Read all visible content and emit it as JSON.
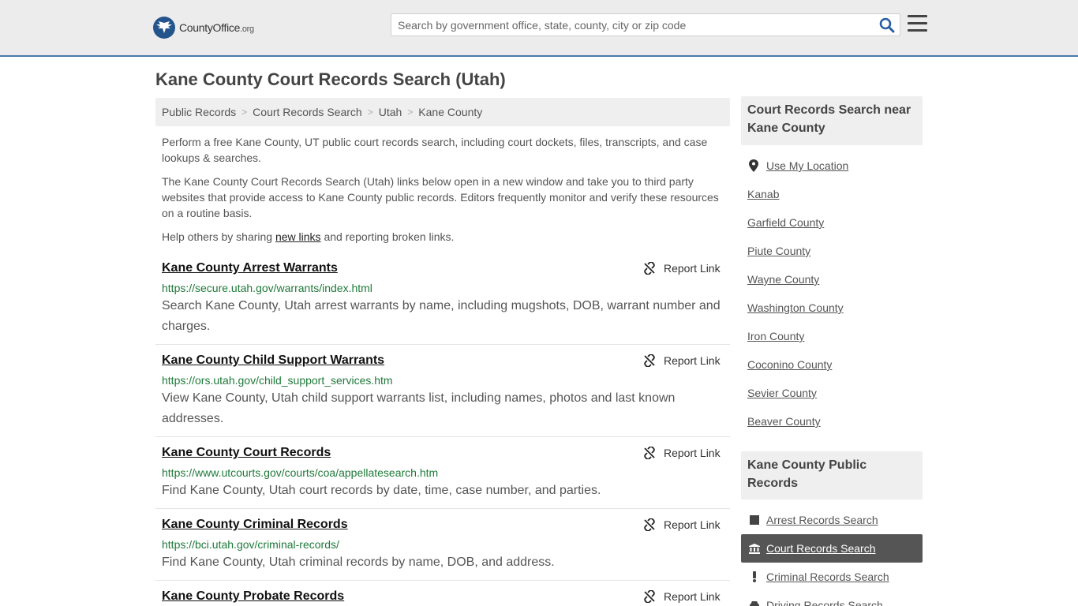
{
  "header": {
    "logo_main": "CountyOffice",
    "logo_org": ".org",
    "search_placeholder": "Search by government office, state, county, city or zip code"
  },
  "page_title": "Kane County Court Records Search (Utah)",
  "breadcrumb": [
    "Public Records",
    "Court Records Search",
    "Utah",
    "Kane County"
  ],
  "intro": {
    "p1": "Perform a free Kane County, UT public court records search, including court dockets, files, transcripts, and case lookups & searches.",
    "p2": "The Kane County Court Records Search (Utah) links below open in a new window and take you to third party websites that provide access to Kane County public records. Editors frequently monitor and verify these resources on a routine basis.",
    "p3_before": "Help others by sharing ",
    "p3_link": "new links",
    "p3_after": " and reporting broken links."
  },
  "report_label": "Report Link",
  "listings": [
    {
      "title": "Kane County Arrest Warrants",
      "url": "https://secure.utah.gov/warrants/index.html",
      "desc": "Search Kane County, Utah arrest warrants by name, including mugshots, DOB, warrant number and charges."
    },
    {
      "title": "Kane County Child Support Warrants",
      "url": "https://ors.utah.gov/child_support_services.htm",
      "desc": "View Kane County, Utah child support warrants list, including names, photos and last known addresses."
    },
    {
      "title": "Kane County Court Records",
      "url": "https://www.utcourts.gov/courts/coa/appellatesearch.htm",
      "desc": "Find Kane County, Utah court records by date, time, case number, and parties."
    },
    {
      "title": "Kane County Criminal Records",
      "url": "https://bci.utah.gov/criminal-records/",
      "desc": "Find Kane County, Utah criminal records by name, DOB, and address."
    },
    {
      "title": "Kane County Probate Records",
      "url": "",
      "desc": ""
    }
  ],
  "sidebar": {
    "nearby_heading": "Court Records Search near Kane County",
    "use_location": "Use My Location",
    "nearby": [
      "Kanab",
      "Garfield County",
      "Piute County",
      "Wayne County",
      "Washington County",
      "Iron County",
      "Coconino County",
      "Sevier County",
      "Beaver County"
    ],
    "public_heading": "Kane County Public Records",
    "records": [
      {
        "label": "Arrest Records Search",
        "icon": "square-icon"
      },
      {
        "label": "Court Records Search",
        "icon": "courthouse-icon",
        "active": true
      },
      {
        "label": "Criminal Records Search",
        "icon": "exclamation-icon"
      },
      {
        "label": "Driving Records Search",
        "icon": "car-icon"
      }
    ]
  },
  "colors": {
    "accent": "#4a78a8",
    "url_green": "#1f7a3a",
    "active_bg": "#555555",
    "logo_blue": "#24548c"
  }
}
